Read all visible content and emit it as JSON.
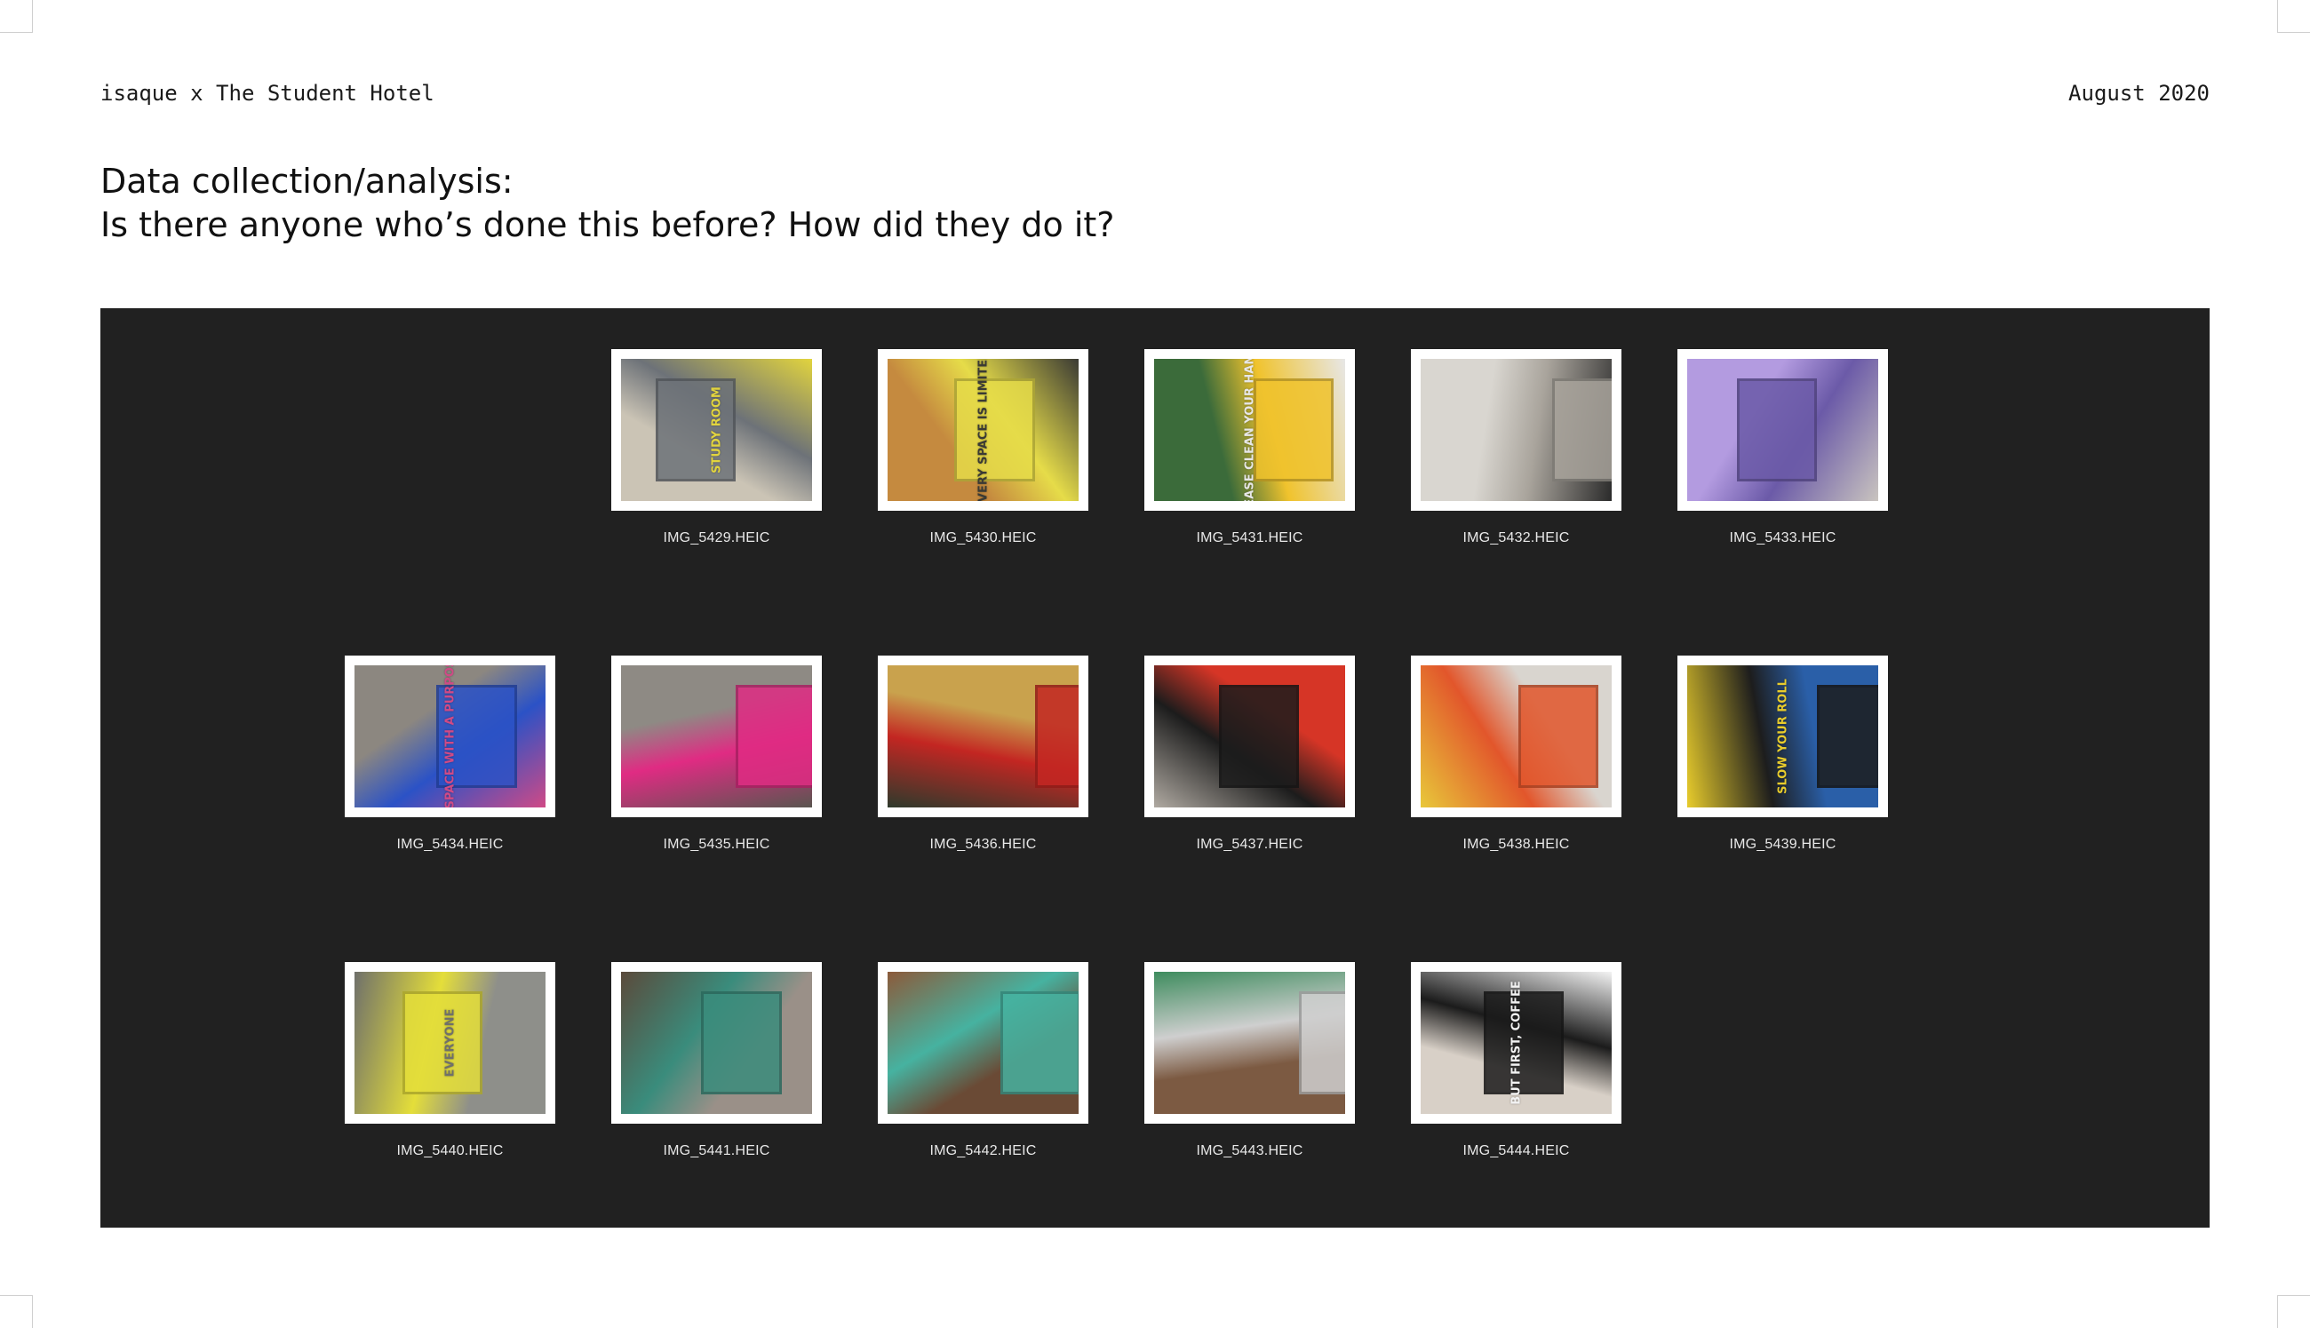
{
  "header": {
    "left_text": "isaque x The Student Hotel",
    "right_text": "August 2020"
  },
  "heading": {
    "line1": "Data collection/analysis:",
    "line2": "Is there anyone who’s done this before? How did they do it?"
  },
  "gallery": {
    "background": "#212121",
    "items": [
      {
        "filename": "IMG_5429.HEIC",
        "thumb_text": "STUDY ROOM",
        "thumb_colors": [
          "#cbc4b5",
          "#6d7278",
          "#e2d43e"
        ]
      },
      {
        "filename": "IMG_5430.HEIC",
        "thumb_text": "EVERY SPACE IS LIMITED",
        "thumb_colors": [
          "#c58a3f",
          "#e6dc49",
          "#3a3a34"
        ]
      },
      {
        "filename": "IMG_5431.HEIC",
        "thumb_text": "PLEASE CLEAN YOUR HANDS",
        "thumb_colors": [
          "#3b6b3a",
          "#f0c32d",
          "#e7e7e7"
        ]
      },
      {
        "filename": "IMG_5432.HEIC",
        "thumb_text": "",
        "thumb_colors": [
          "#d9d6d0",
          "#a9a49c",
          "#2b2b2b"
        ]
      },
      {
        "filename": "IMG_5433.HEIC",
        "thumb_text": "",
        "thumb_colors": [
          "#b39be0",
          "#6b5aa8",
          "#c9c4bf"
        ]
      },
      {
        "filename": "IMG_5434.HEIC",
        "thumb_text": "A SPACE WITH A PURPOSE",
        "thumb_colors": [
          "#8c8780",
          "#2b52c6",
          "#d04a86"
        ]
      },
      {
        "filename": "IMG_5435.HEIC",
        "thumb_text": "",
        "thumb_colors": [
          "#8e8a84",
          "#e02b83",
          "#5a5650"
        ]
      },
      {
        "filename": "IMG_5436.HEIC",
        "thumb_text": "",
        "thumb_colors": [
          "#c9a24d",
          "#c32622",
          "#2e3a2c"
        ]
      },
      {
        "filename": "IMG_5437.HEIC",
        "thumb_text": "",
        "thumb_colors": [
          "#d63526",
          "#1c1c1c",
          "#b0aaa2"
        ]
      },
      {
        "filename": "IMG_5438.HEIC",
        "thumb_text": "",
        "thumb_colors": [
          "#d9d5cf",
          "#e2562b",
          "#e8c83a"
        ]
      },
      {
        "filename": "IMG_5439.HEIC",
        "thumb_text": "SLOW YOUR ROLL",
        "thumb_colors": [
          "#2a5fa8",
          "#1d1d1d",
          "#e8cc2c"
        ]
      },
      {
        "filename": "IMG_5440.HEIC",
        "thumb_text": "EVERYONE",
        "thumb_colors": [
          "#8e8f8a",
          "#e4de3a",
          "#6f706b"
        ]
      },
      {
        "filename": "IMG_5441.HEIC",
        "thumb_text": "",
        "thumb_colors": [
          "#9a9088",
          "#3a8c7c",
          "#5b4a3b"
        ]
      },
      {
        "filename": "IMG_5442.HEIC",
        "thumb_text": "",
        "thumb_colors": [
          "#6a4a35",
          "#46b2a0",
          "#8c5a3a"
        ]
      },
      {
        "filename": "IMG_5443.HEIC",
        "thumb_text": "",
        "thumb_colors": [
          "#7c5a42",
          "#cfcfcf",
          "#3e8c5e"
        ]
      },
      {
        "filename": "IMG_5444.HEIC",
        "thumb_text": "BUT FIRST, COFFEE",
        "thumb_colors": [
          "#d8d0c7",
          "#1b1b1b",
          "#f3f3f3"
        ]
      }
    ]
  }
}
